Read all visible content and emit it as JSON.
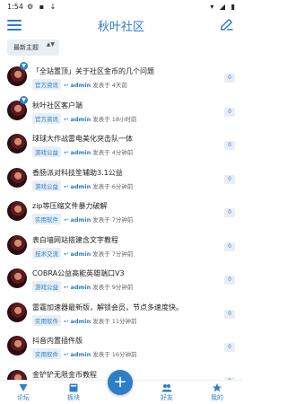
{
  "status": {
    "time": "1:54",
    "left_icons": "⚙ ▪ ↓",
    "right_icons": "▾ ◢ ▮"
  },
  "appbar": {
    "title": "秋叶社区"
  },
  "filter": {
    "label": "最新主题",
    "arrows": "▲▼"
  },
  "common": {
    "author": "admin",
    "reply_icon": "↩"
  },
  "items": [
    {
      "title": "「全站置顶」关于社区金币的几个问题",
      "tag": "官方资讯",
      "time": "发表于 4天前",
      "count": "0",
      "pinned": true
    },
    {
      "title": "秋叶社区客户端",
      "tag": "官方资讯",
      "time": "发表于 18小时前",
      "count": "0",
      "pinned": true
    },
    {
      "title": "球球大作战雷电美化突击队一体",
      "tag": "游戏公益",
      "time": "发表于 4分钟前",
      "count": "0"
    },
    {
      "title": "香肠派对科技笙辅助3.1公益",
      "tag": "游戏公益",
      "time": "发表于 6分钟前",
      "count": "0"
    },
    {
      "title": "zip等压缩文件暴力破解",
      "tag": "实用软件",
      "time": "发表于 7分钟前",
      "count": "0"
    },
    {
      "title": "表白墙网站搭建含文字教程",
      "tag": "技术交流",
      "time": "发表于 7分钟前",
      "count": "0"
    },
    {
      "title": "COBRA公益高能英雄端口V3",
      "tag": "游戏公益",
      "time": "发表于 9分钟前",
      "count": "0"
    },
    {
      "title": "雷霆加速器最新版，解锁会员，节点多速度快。",
      "tag": "实用软件",
      "time": "发表于 11分钟前",
      "count": "0"
    },
    {
      "title": "抖音内置插件版",
      "tag": "实用软件",
      "time": "发表于 16分钟前",
      "count": "0"
    },
    {
      "title": "金铲铲无限金币教程",
      "tag": "",
      "time": "",
      "count": "0"
    }
  ],
  "tabbar": {
    "forum": "论坛",
    "sections": "板块",
    "add": "+",
    "friends": "好友",
    "mine": "我的"
  },
  "colors": {
    "accent": "#2d7ec9",
    "tag_bg": "#e7eef5"
  }
}
